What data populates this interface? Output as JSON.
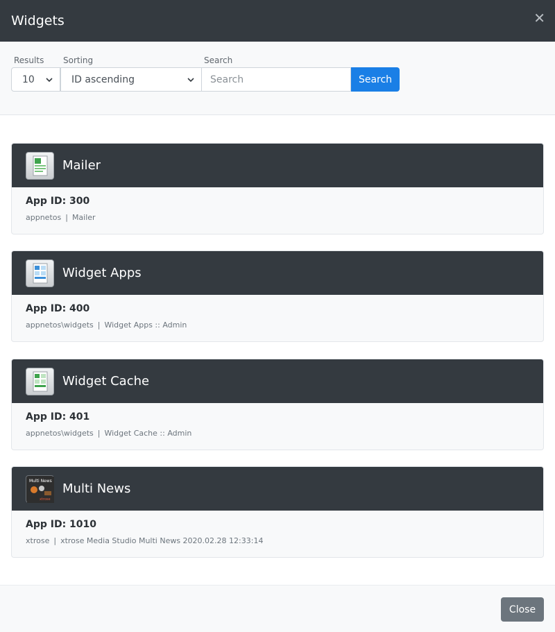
{
  "modal": {
    "title": "Widgets",
    "close_label": "Close"
  },
  "filters": {
    "results_label": "Results",
    "results_value": "10",
    "sorting_label": "Sorting",
    "sorting_value": "ID ascending",
    "search_label": "Search",
    "search_placeholder": "Search",
    "search_button": "Search"
  },
  "apps": [
    {
      "title": "Mailer",
      "app_id": "App ID: 300",
      "namespace": "appnetos",
      "description": "Mailer",
      "icon": "document-app-icon"
    },
    {
      "title": "Widget Apps",
      "app_id": "App ID: 400",
      "namespace": "appnetos\\widgets",
      "description": "Widget Apps :: Admin",
      "icon": "widget-grid-icon"
    },
    {
      "title": "Widget Cache",
      "app_id": "App ID: 401",
      "namespace": "appnetos\\widgets",
      "description": "Widget Cache :: Admin",
      "icon": "widget-grid-icon"
    },
    {
      "title": "Multi News",
      "app_id": "App ID: 1010",
      "namespace": "xtrose",
      "description": "xtrose Media Studio Multi News 2020.02.28 12:33:14",
      "icon": "multi-news-icon",
      "icon_text": "Multi News",
      "icon_brand": "xtrose"
    }
  ],
  "separator": "|"
}
